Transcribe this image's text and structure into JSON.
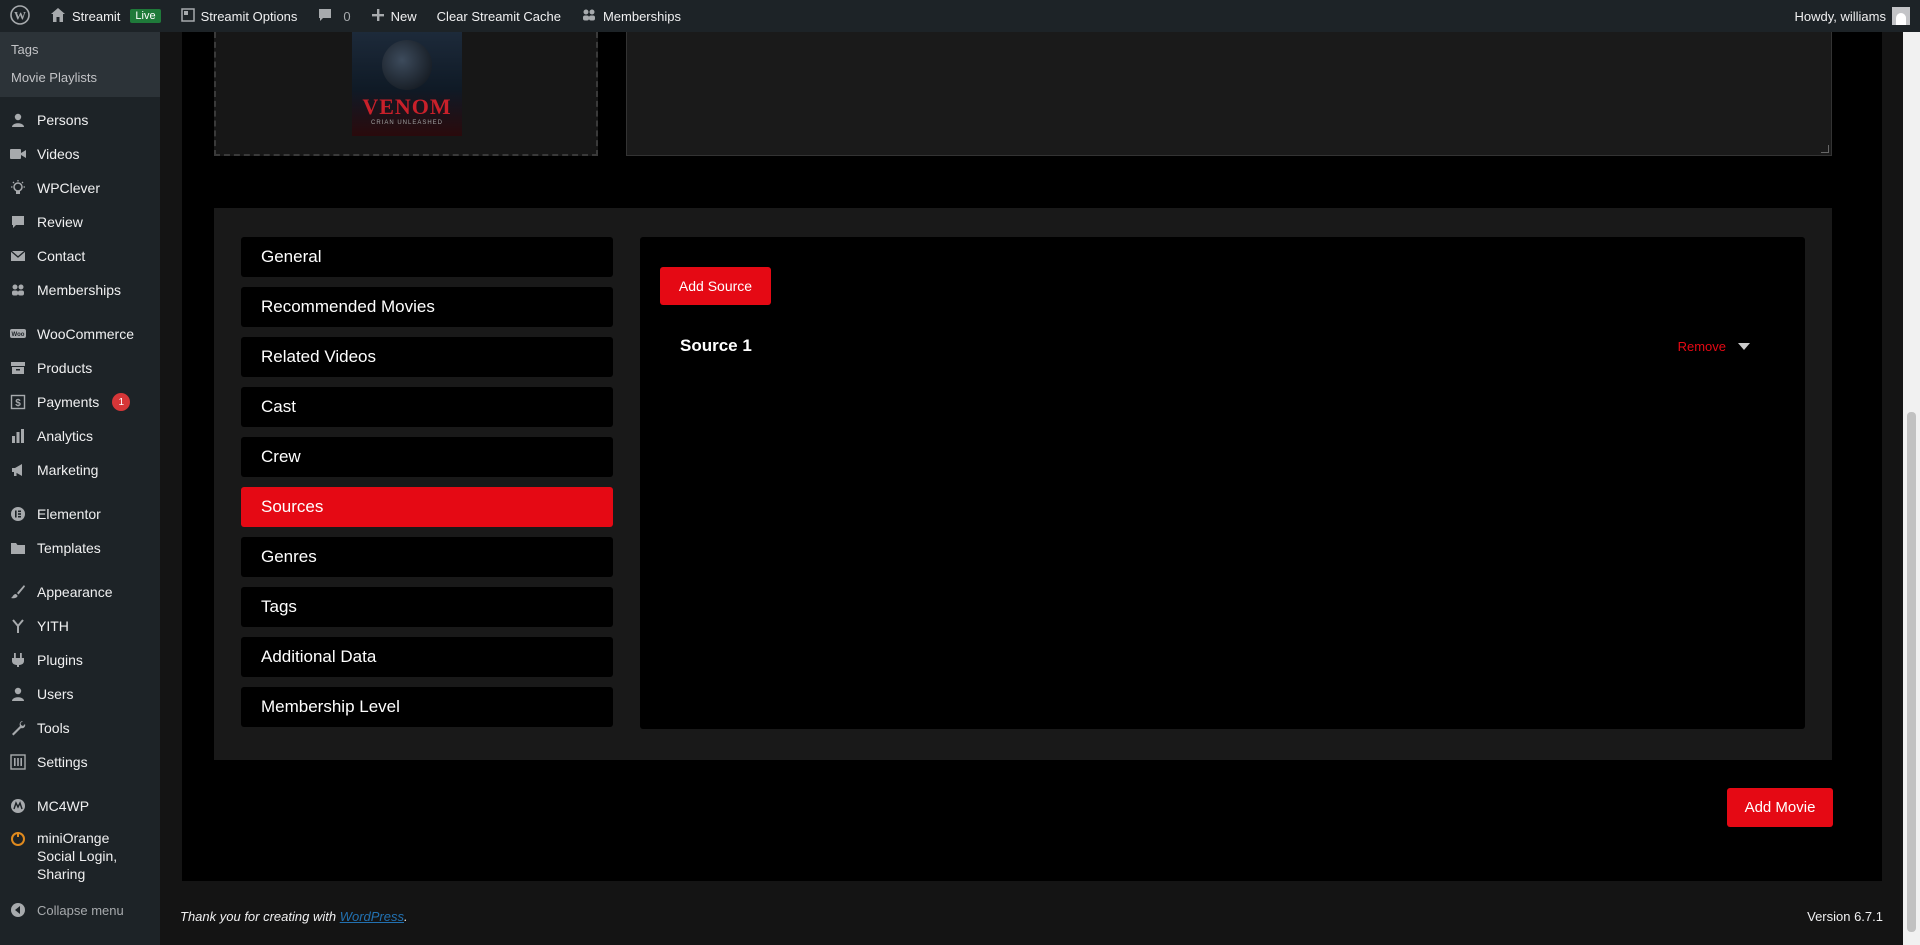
{
  "adminbar": {
    "site_name": "Streamit",
    "live_label": "Live",
    "options_label": "Streamit Options",
    "comments_count": "0",
    "new_label": "New",
    "clear_cache_label": "Clear Streamit Cache",
    "memberships_label": "Memberships",
    "howdy_label": "Howdy, williams"
  },
  "sidebar": {
    "submenu": [
      {
        "label": "Tags"
      },
      {
        "label": "Movie Playlists"
      }
    ],
    "items": [
      {
        "label": "Persons",
        "icon": "person-icon"
      },
      {
        "label": "Videos",
        "icon": "video-camera-icon"
      },
      {
        "label": "WPClever",
        "icon": "lightbulb-icon"
      },
      {
        "label": "Review",
        "icon": "speech-bubble-icon"
      },
      {
        "label": "Contact",
        "icon": "envelope-icon"
      },
      {
        "label": "Memberships",
        "icon": "group-icon"
      },
      {
        "label": "WooCommerce",
        "icon": "woocommerce-icon"
      },
      {
        "label": "Products",
        "icon": "archive-icon"
      },
      {
        "label": "Payments",
        "icon": "dollar-icon",
        "badge": "1"
      },
      {
        "label": "Analytics",
        "icon": "bar-chart-icon"
      },
      {
        "label": "Marketing",
        "icon": "megaphone-icon"
      },
      {
        "label": "Elementor",
        "icon": "elementor-icon"
      },
      {
        "label": "Templates",
        "icon": "folder-icon"
      },
      {
        "label": "Appearance",
        "icon": "paintbrush-icon"
      },
      {
        "label": "YITH",
        "icon": "yith-icon"
      },
      {
        "label": "Plugins",
        "icon": "plug-icon"
      },
      {
        "label": "Users",
        "icon": "users-icon"
      },
      {
        "label": "Tools",
        "icon": "wrench-icon"
      },
      {
        "label": "Settings",
        "icon": "settings-sliders-icon"
      },
      {
        "label": "MC4WP",
        "icon": "mc4wp-icon"
      },
      {
        "label": "miniOrange Social Login, Sharing",
        "icon": "miniorange-icon"
      }
    ],
    "collapse_label": "Collapse menu"
  },
  "poster": {
    "title": "VENOM",
    "subtitle": "CRIAN UNLEASHED"
  },
  "tabs": [
    {
      "label": "General",
      "active": false
    },
    {
      "label": "Recommended Movies",
      "active": false
    },
    {
      "label": "Related Videos",
      "active": false
    },
    {
      "label": "Cast",
      "active": false
    },
    {
      "label": "Crew",
      "active": false
    },
    {
      "label": "Sources",
      "active": true
    },
    {
      "label": "Genres",
      "active": false
    },
    {
      "label": "Tags",
      "active": false
    },
    {
      "label": "Additional Data",
      "active": false
    },
    {
      "label": "Membership Level",
      "active": false
    }
  ],
  "sources": {
    "add_label": "Add Source",
    "items": [
      {
        "title": "Source 1",
        "remove_label": "Remove"
      }
    ]
  },
  "add_movie_label": "Add Movie",
  "footer": {
    "thanks_prefix": "Thank you for creating with ",
    "wp_link": "WordPress",
    "thanks_suffix": ".",
    "version": "Version 6.7.1"
  },
  "colors": {
    "accent": "#e50914",
    "adminbar": "#1d2327",
    "panel": "#191919"
  }
}
